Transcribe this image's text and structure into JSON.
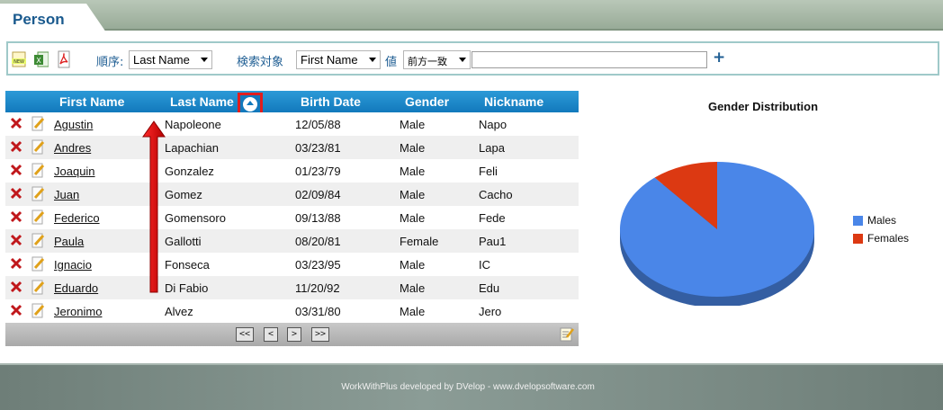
{
  "tab": {
    "title": "Person"
  },
  "toolbar": {
    "icons": [
      "new-icon",
      "excel-icon",
      "pdf-icon"
    ],
    "order_label": "順序:",
    "order_value": "Last Name",
    "search_target_label": "検索対象",
    "search_target_value": "First Name",
    "value_label": "値",
    "match_value": "前方一致",
    "search_value": "",
    "add_label": "+"
  },
  "grid": {
    "columns": [
      "First Name",
      "Last Name",
      "Birth Date",
      "Gender",
      "Nickname"
    ],
    "sort_column": "Last Name",
    "rows": [
      {
        "first": "Agustin",
        "last": "Napoleone",
        "birth": "12/05/88",
        "gender": "Male",
        "nick": "Napo"
      },
      {
        "first": "Andres",
        "last": "Lapachian",
        "birth": "03/23/81",
        "gender": "Male",
        "nick": "Lapa"
      },
      {
        "first": "Joaquin",
        "last": "Gonzalez",
        "birth": "01/23/79",
        "gender": "Male",
        "nick": "Feli"
      },
      {
        "first": "Juan",
        "last": "Gomez",
        "birth": "02/09/84",
        "gender": "Male",
        "nick": "Cacho"
      },
      {
        "first": "Federico",
        "last": "Gomensoro",
        "birth": "09/13/88",
        "gender": "Male",
        "nick": "Fede"
      },
      {
        "first": "Paula",
        "last": "Gallotti",
        "birth": "08/20/81",
        "gender": "Female",
        "nick": "Pau1"
      },
      {
        "first": "Ignacio",
        "last": "Fonseca",
        "birth": "03/23/95",
        "gender": "Male",
        "nick": "IC"
      },
      {
        "first": "Eduardo",
        "last": "Di Fabio",
        "birth": "11/20/92",
        "gender": "Male",
        "nick": "Edu"
      },
      {
        "first": "Jeronimo",
        "last": "Alvez",
        "birth": "03/31/80",
        "gender": "Male",
        "nick": "Jero"
      }
    ],
    "pager": [
      "<<",
      "<",
      ">",
      ">>"
    ]
  },
  "chart_data": {
    "type": "pie",
    "title": "Gender Distribution",
    "categories": [
      "Males",
      "Females"
    ],
    "values": [
      8,
      1
    ],
    "colors": [
      "#4a86e8",
      "#dc3912"
    ],
    "legend": "right"
  },
  "footer": {
    "text": "WorkWithPlus developed by DVelop - www.dvelopsoftware.com"
  },
  "colors": {
    "header_blue": "#1a84c8",
    "accent_red": "#e11d1d",
    "tab_text": "#1a5a8e"
  }
}
